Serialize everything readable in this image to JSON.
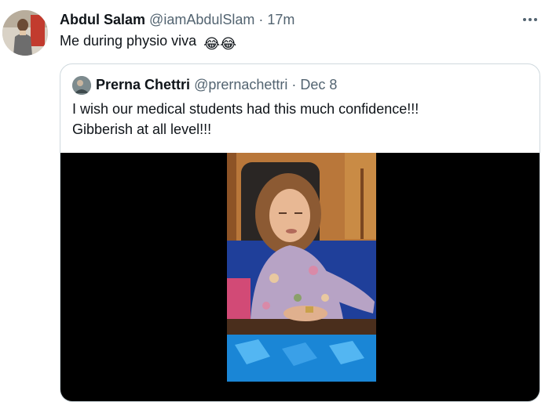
{
  "tweet": {
    "author_name": "Abdul Salam",
    "author_handle": "@iamAbdulSlam",
    "separator": "·",
    "time": "17m",
    "text": "Me during physio viva",
    "emoji": "😂😂",
    "more_icon": "more-horizontal-icon"
  },
  "quoted_tweet": {
    "author_name": "Prerna Chettri",
    "author_handle": "@prernachettri",
    "separator": "·",
    "date": "Dec 8",
    "text_line1": "I wish our medical students had this much confidence!!!",
    "text_line2": "Gibberish at all level!!!",
    "media_type": "video"
  },
  "colors": {
    "text_primary": "#0f1419",
    "text_secondary": "#536471",
    "border": "#cfd9de",
    "media_background": "#000000"
  }
}
